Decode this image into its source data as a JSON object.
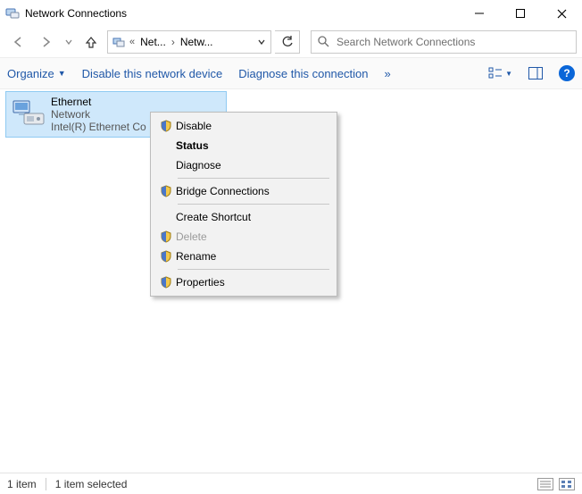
{
  "titlebar": {
    "title": "Network Connections"
  },
  "nav": {
    "breadcrumb": {
      "seg1": "Net...",
      "seg2": "Netw..."
    }
  },
  "search": {
    "placeholder": "Search Network Connections"
  },
  "cmdbar": {
    "organize": "Organize",
    "disable_device": "Disable this network device",
    "diagnose": "Diagnose this connection",
    "overflow": "»"
  },
  "adapter": {
    "name": "Ethernet",
    "status": "Network",
    "device": "Intel(R) Ethernet Co"
  },
  "context_menu": {
    "disable": "Disable",
    "status": "Status",
    "diagnose": "Diagnose",
    "bridge": "Bridge Connections",
    "create_shortcut": "Create Shortcut",
    "delete": "Delete",
    "rename": "Rename",
    "properties": "Properties"
  },
  "statusbar": {
    "count": "1 item",
    "selected": "1 item selected"
  }
}
